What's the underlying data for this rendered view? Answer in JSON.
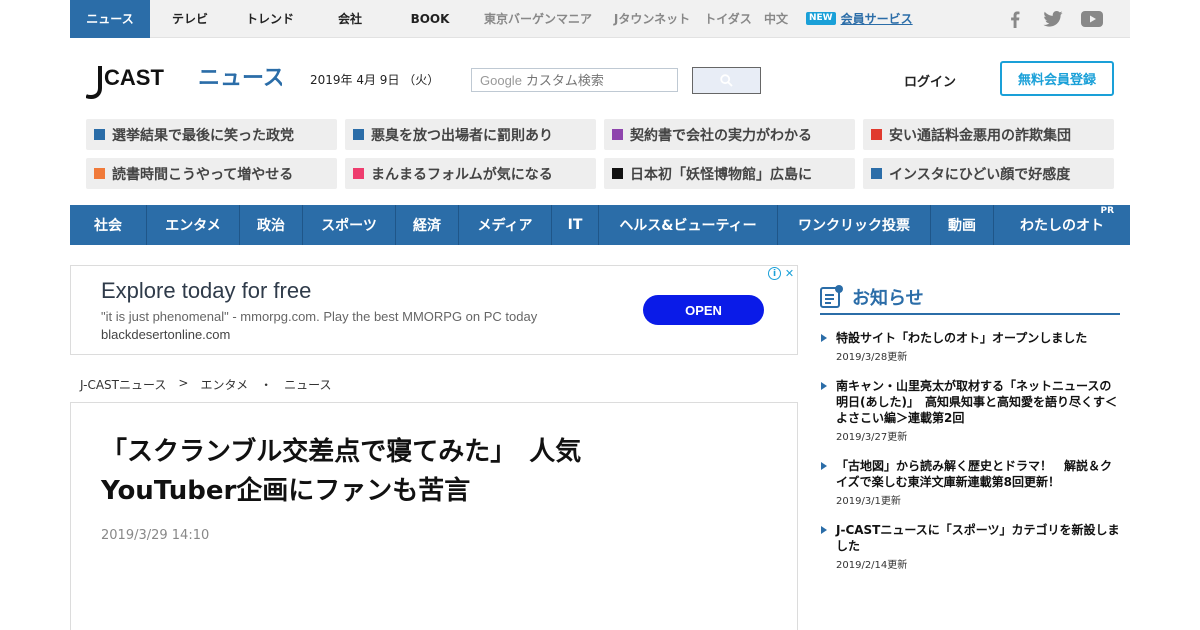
{
  "top_nav": {
    "tabs": [
      "ニュース",
      "テレビ",
      "トレンド",
      "会社",
      "BOOK"
    ],
    "partner_links": [
      "東京バーゲンマニア",
      "Jタウンネット",
      "トイダス",
      "中文"
    ],
    "new_badge": "NEW",
    "member_service": "会員サービス",
    "social_icons": [
      "facebook-icon",
      "twitter-icon",
      "youtube-icon"
    ]
  },
  "header": {
    "logo_text": "J CAST ニュース",
    "date": "2019年 4月 9日 （火）",
    "search_placeholder": "カスタム検索",
    "search_brand": "Google",
    "login": "ログイン",
    "register": "無料会員登録"
  },
  "topics": [
    {
      "label": "選挙結果で最後に笑った政党",
      "color": "#2b6da8"
    },
    {
      "label": "悪臭を放つ出場者に罰則あり",
      "color": "#2b6da8"
    },
    {
      "label": "契約書で会社の実力がわかる",
      "color": "#8e44ad"
    },
    {
      "label": "安い通話料金悪用の詐欺集団",
      "color": "#e03a2e"
    },
    {
      "label": "読書時間こうやって増やせる",
      "color": "#f07a3a"
    },
    {
      "label": "まんまるフォルムが気になる",
      "color": "#ee3d6e"
    },
    {
      "label": "日本初「妖怪博物館」広島に",
      "color": "#111111"
    },
    {
      "label": "インスタにひどい顔で好感度",
      "color": "#2b6da8"
    }
  ],
  "categories": [
    {
      "label": "社会"
    },
    {
      "label": "エンタメ"
    },
    {
      "label": "政治"
    },
    {
      "label": "スポーツ"
    },
    {
      "label": "経済"
    },
    {
      "label": "メディア"
    },
    {
      "label": "IT"
    },
    {
      "label": "ヘルス&ビューティー"
    },
    {
      "label": "ワンクリック投票"
    },
    {
      "label": "動画"
    },
    {
      "label": "わたしのオト",
      "pr": "PR"
    }
  ],
  "ad": {
    "title": "Explore today for free",
    "text": "\"it is just phenomenal\" - mmorpg.com. Play the best MMORPG on PC today",
    "url": "blackdesertonline.com",
    "cta": "OPEN",
    "info": "i",
    "close": "✕"
  },
  "breadcrumb": [
    "J-CASTニュース",
    ">",
    "エンタメ",
    "・",
    "ニュース"
  ],
  "article": {
    "title": "「スクランブル交差点で寝てみた」　人気YouTuber企画にファンも苦言",
    "date": "2019/3/29 14:10"
  },
  "notices": {
    "heading": "お知らせ",
    "items": [
      {
        "text": "特設サイト「わたしのオト」オープンしました",
        "updated": "2019/3/28更新"
      },
      {
        "text": "南キャン・山里亮太が取材する「ネットニュースの明日(あした)」　高知県知事と高知愛を語り尽くす＜よさこい編＞連載第2回",
        "updated": "2019/3/27更新"
      },
      {
        "text": "「古地図」から読み解く歴史とドラマ！　解説＆クイズで楽しむ東洋文庫新連載第8回更新！",
        "updated": "2019/3/1更新"
      },
      {
        "text": "J-CASTニュースに「スポーツ」カテゴリを新設しました",
        "updated": "2019/2/14更新"
      }
    ]
  }
}
